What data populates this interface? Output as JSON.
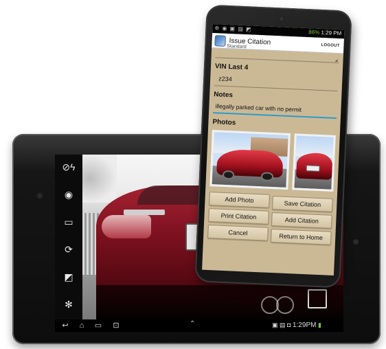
{
  "tablet": {
    "camera_controls": [
      {
        "name": "flash-off-icon",
        "glyph": "⊘ϟ"
      },
      {
        "name": "camera-switch-icon",
        "glyph": "◉"
      },
      {
        "name": "aspect-ratio-icon",
        "glyph": "▭"
      },
      {
        "name": "timer-icon",
        "glyph": "⟳"
      },
      {
        "name": "exposure-icon",
        "glyph": "◩"
      },
      {
        "name": "settings-gear-icon",
        "glyph": "✻"
      }
    ],
    "nav_icons": [
      "back-icon",
      "home-icon",
      "recent-apps-icon",
      "screenshot-icon"
    ],
    "nav_glyphs": {
      "back": "↩",
      "home": "⌂",
      "recent": "▭",
      "screenshot": "⊡",
      "up": "⌃"
    },
    "status_bar": {
      "clock": "1:29",
      "ampm": "PM",
      "icons_text": "▣ ▤ ◘"
    }
  },
  "phone": {
    "status_bar": {
      "battery": "86%",
      "time": "1:29 PM",
      "left_icons": "⊕ ◉ ▣ ▤ ◩"
    },
    "action_bar": {
      "title": "Issue Citation",
      "logout_label": "LOGOUT",
      "underlying_text": "Standard"
    },
    "form": {
      "vin_label": "VIN Last 4",
      "vin_value": "z234",
      "notes_label": "Notes",
      "notes_value": "illegally parked car with no permit",
      "photos_label": "Photos"
    },
    "buttons": {
      "add_photo": "Add Photo",
      "save_citation": "Save Citation",
      "print_citation": "Print Citation",
      "add_citation": "Add Citation",
      "cancel": "Cancel",
      "return_home": "Return to Home"
    }
  },
  "colors": {
    "form_background": "#cbb996",
    "notes_underline": "#2e9bc9",
    "car_red": "#a42231"
  }
}
